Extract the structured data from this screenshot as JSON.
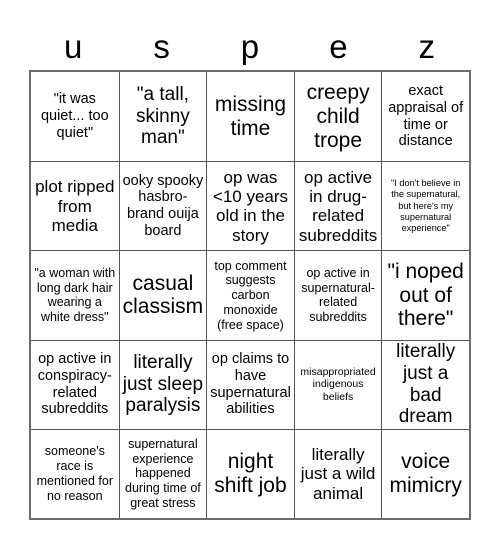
{
  "card": {
    "header_letters": [
      "u",
      "s",
      "p",
      "e",
      "z"
    ],
    "rows": [
      [
        {
          "text": "\"it was quiet... too quiet\"",
          "size": "md"
        },
        {
          "text": "\"a tall, skinny man\"",
          "size": "xl"
        },
        {
          "text": "missing time",
          "size": "xxl"
        },
        {
          "text": "creepy child trope",
          "size": "xxl"
        },
        {
          "text": "exact appraisal of time or distance",
          "size": "md"
        }
      ],
      [
        {
          "text": "plot ripped from media",
          "size": "lg"
        },
        {
          "text": "ooky spooky hasbro-brand ouija board",
          "size": "md"
        },
        {
          "text": "op was <10 years old in the story",
          "size": "lg"
        },
        {
          "text": "op active in drug-related subreddits",
          "size": "lg"
        },
        {
          "text": "\"I don't believe in the supernatural, but here's my supernatural experience\"",
          "size": "xxs"
        }
      ],
      [
        {
          "text": "\"a woman with long dark hair wearing a white dress\"",
          "size": "sm"
        },
        {
          "text": "casual classism",
          "size": "xxl"
        },
        {
          "text": "top comment suggests carbon monoxide (free space)",
          "size": "sm"
        },
        {
          "text": "op active in supernatural-related subreddits",
          "size": "sm"
        },
        {
          "text": "\"i noped out of there\"",
          "size": "xxl"
        }
      ],
      [
        {
          "text": "op active in conspiracy-related subreddits",
          "size": "md"
        },
        {
          "text": "literally just sleep paralysis",
          "size": "xl"
        },
        {
          "text": "op claims to have supernatural abilities",
          "size": "md"
        },
        {
          "text": "misappropriated indigenous beliefs",
          "size": "xs"
        },
        {
          "text": "literally just a bad dream",
          "size": "xl"
        }
      ],
      [
        {
          "text": "someone's race is mentioned for no reason",
          "size": "sm"
        },
        {
          "text": "supernatural experience happened during time of great stress",
          "size": "sm"
        },
        {
          "text": "night shift job",
          "size": "xxl"
        },
        {
          "text": "literally just a wild animal",
          "size": "lg"
        },
        {
          "text": "voice mimicry",
          "size": "xxl"
        }
      ]
    ]
  }
}
